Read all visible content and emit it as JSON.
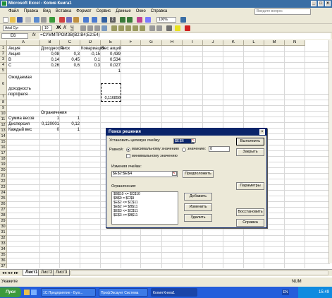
{
  "window": {
    "title": "Microsoft Excel - Копия Книга1"
  },
  "menu": {
    "items": [
      "Файл",
      "Правка",
      "Вид",
      "Вставка",
      "Формат",
      "Сервис",
      "Данные",
      "Окно",
      "Справка"
    ],
    "help_placeholder": "Введите вопрос"
  },
  "toolbar": {
    "font": "Arial Cyr",
    "size": "10",
    "zoom": "100%"
  },
  "formula_bar": {
    "name_box": "E6",
    "fx": "fx",
    "formula": "=СУММПРОИЗВ(B2:B4;E2:E4)"
  },
  "columns": [
    "A",
    "B",
    "C",
    "D",
    "E",
    "F",
    "G",
    "H",
    "I",
    "J",
    "K",
    "L",
    "M",
    "N"
  ],
  "rows": [
    "1",
    "2",
    "3",
    "4",
    "5",
    "6",
    "7",
    "8",
    "9",
    "10",
    "11",
    "12",
    "13",
    "14",
    "15",
    "16",
    "17",
    "18",
    "19",
    "20",
    "21",
    "22",
    "23",
    "24",
    "25",
    "26",
    "27",
    "28",
    "29",
    "30",
    "31",
    "32",
    "33",
    "34",
    "35",
    "36",
    "37"
  ],
  "cells": {
    "a1": "Акция",
    "b1": "Доходность",
    "c1": "Риск",
    "d1": "Ковариация",
    "e1": "Вес акций",
    "a2": "Акция",
    "b2": "0,08",
    "c2": "0,3",
    "d2": "-0,15",
    "e2": "0,439",
    "a3": "B",
    "b3": "0,14",
    "c3": "0,45",
    "d3": "0,1",
    "e3": "0,534",
    "a4": "C",
    "b4": "0,26",
    "c4": "0,6",
    "d4": "0,3",
    "e4": "0,027",
    "e5": "1",
    "a6_l1": "Ожидаемая",
    "a6_l2": "доходность",
    "a6_l3": "портфеля",
    "e6": "0,116856",
    "b8": "Ограничения",
    "a9": "Сумма весов",
    "b9": "1",
    "c9": "1",
    "a10": "Дисперсия",
    "b10": "0,120001",
    "c10": "0,12",
    "a11": "Каждый вес",
    "b11": "0",
    "c11": "1"
  },
  "sheet_tabs": [
    "Лист1",
    "Лист2",
    "Лист3"
  ],
  "status": {
    "left": "Укажите",
    "num": "NUM"
  },
  "taskbar": {
    "start": "Пуск",
    "items": [
      "1С:Предприятие - Бухг...",
      "ПрофЭксаунт Система",
      "Копия Книга1"
    ],
    "time": "15:49",
    "lang": "EN"
  },
  "solver": {
    "title": "Поиск решения",
    "target_label": "Установить целевую ячейку:",
    "target_value": "$E$6",
    "equal_label": "Равной:",
    "opt_max": "максимальному значению",
    "opt_value": "значению:",
    "value_field": "0",
    "opt_min": "минимальному значению",
    "changing_label": "Изменяя ячейки:",
    "changing_value": "$E$2:$E$4",
    "guess": "Предположить",
    "constraints_label": "Ограничения:",
    "constraints": [
      "$B$10 <= $C$10",
      "$B$9 = $C$9",
      "$E$2 <= $C$11",
      "$E$2 >= $B$11",
      "$E$3 <= $C$11",
      "$E$3 >= $B$11"
    ],
    "btn_run": "Выполнить",
    "btn_close": "Закрыть",
    "btn_params": "Параметры",
    "btn_add": "Добавить",
    "btn_change": "Изменить",
    "btn_delete": "Удалить",
    "btn_restore": "Восстановить",
    "btn_help": "Справка"
  }
}
